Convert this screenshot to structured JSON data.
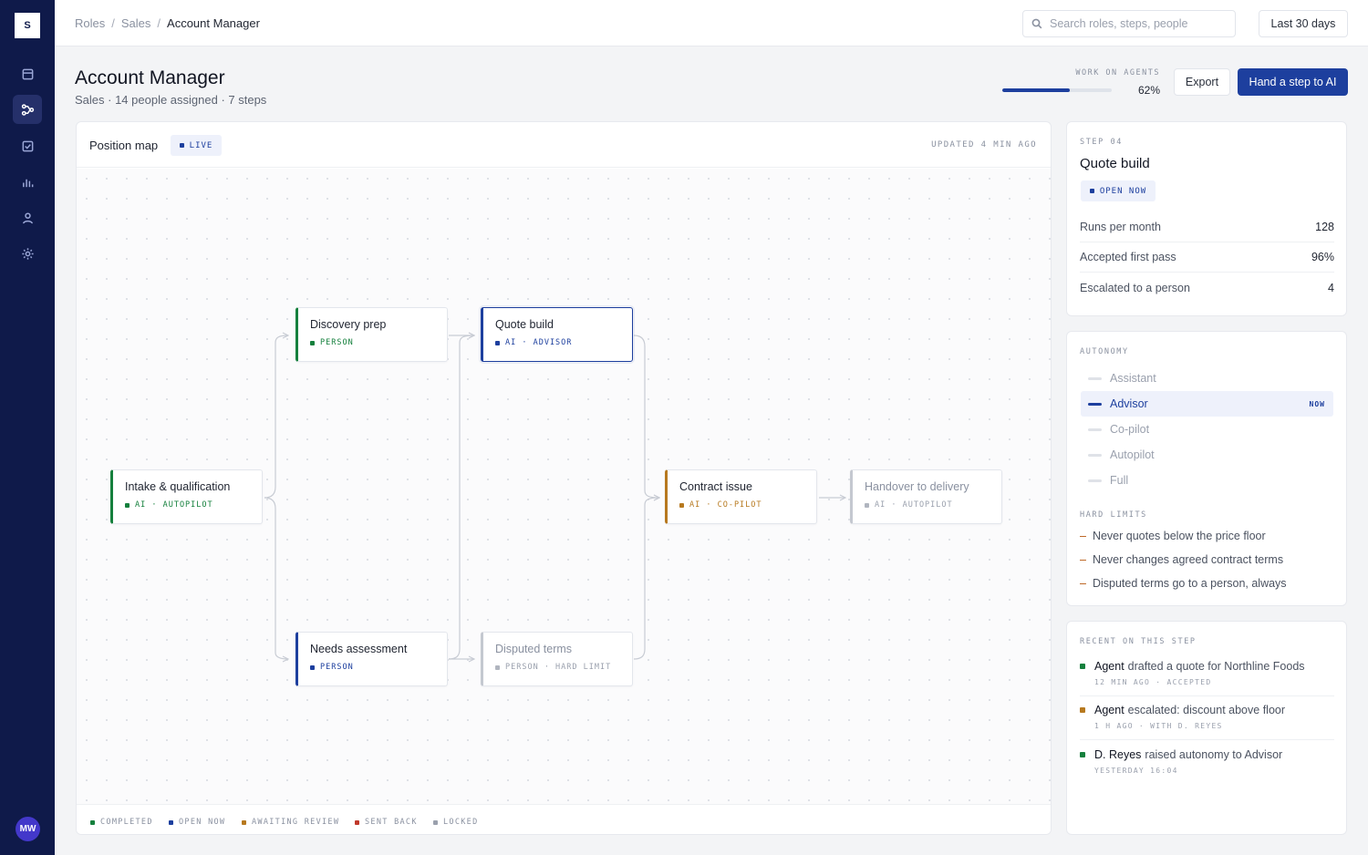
{
  "app": {
    "logo": "S",
    "user_initials": "MW"
  },
  "colors": {
    "sidebar": "#0f1a4a",
    "primary": "#1d3f9e",
    "completed": "#15803d",
    "open_now": "#1d3f9e",
    "awaiting_review": "#b7791f",
    "sent_back": "#c0392b",
    "locked": "#9aa0ad"
  },
  "sidebar": {
    "items": [
      {
        "icon": "inbox-icon",
        "active": false
      },
      {
        "icon": "workflow-icon",
        "active": true
      },
      {
        "icon": "checkbox-icon",
        "active": false
      },
      {
        "icon": "bar-chart-icon",
        "active": false
      },
      {
        "icon": "person-icon",
        "active": false
      },
      {
        "icon": "gear-icon",
        "active": false
      }
    ]
  },
  "breadcrumb": [
    "Roles",
    "Sales",
    "Account Manager"
  ],
  "search": {
    "placeholder": "Search roles, steps, people",
    "value": ""
  },
  "date_range": "Last 30 days",
  "header": {
    "title": "Account Manager",
    "subtitle": "Sales · 14 people assigned · 7 steps",
    "work_on_agents_label": "WORK ON AGENTS",
    "work_on_agents_value": "62%",
    "work_on_agents_fraction": 0.62,
    "export_label": "Export",
    "hand_label": "Hand a step to AI"
  },
  "map": {
    "title": "Position map",
    "live": "LIVE",
    "updated": "UPDATED 4 MIN AGO",
    "nodes": [
      {
        "id": "intake",
        "title": "Intake & qualification",
        "meta": "AI · AUTOPILOT",
        "status": "completed"
      },
      {
        "id": "discovery",
        "title": "Discovery prep",
        "meta": "PERSON",
        "status": "completed"
      },
      {
        "id": "needs",
        "title": "Needs assessment",
        "meta": "PERSON",
        "status": "open"
      },
      {
        "id": "quote",
        "title": "Quote build",
        "meta": "AI · ADVISOR",
        "status": "open",
        "selected": true
      },
      {
        "id": "disputed",
        "title": "Disputed terms",
        "meta": "PERSON · HARD LIMIT",
        "status": "locked"
      },
      {
        "id": "contract",
        "title": "Contract issue",
        "meta": "AI · CO-PILOT",
        "status": "awaiting"
      },
      {
        "id": "handover",
        "title": "Handover to delivery",
        "meta": "AI · AUTOPILOT",
        "status": "locked"
      }
    ],
    "legend": [
      "COMPLETED",
      "OPEN NOW",
      "AWAITING REVIEW",
      "SENT BACK",
      "LOCKED"
    ]
  },
  "step": {
    "label": "STEP 04",
    "title": "Quote build",
    "badge": "OPEN NOW",
    "stats": [
      {
        "label": "Runs per month",
        "value": "128"
      },
      {
        "label": "Accepted first pass",
        "value": "96%"
      },
      {
        "label": "Escalated to a person",
        "value": "4"
      }
    ]
  },
  "autonomy": {
    "label": "AUTONOMY",
    "levels": [
      "Assistant",
      "Advisor",
      "Co-pilot",
      "Autopilot",
      "Full"
    ],
    "current": "Advisor",
    "now_label": "NOW",
    "limits_label": "HARD LIMITS",
    "limits": [
      "Never quotes below the price floor",
      "Never changes agreed contract terms",
      "Disputed terms go to a person, always"
    ]
  },
  "recent": {
    "label": "RECENT ON THIS STEP",
    "items": [
      {
        "actor": "Agent",
        "text": "drafted a quote for Northline Foods",
        "meta": "12 MIN AGO · ACCEPTED",
        "status": "completed"
      },
      {
        "actor": "Agent",
        "text": "escalated: discount above floor",
        "meta": "1 H AGO · WITH D. REYES",
        "status": "awaiting"
      },
      {
        "actor": "D. Reyes",
        "text": "raised autonomy to Advisor",
        "meta": "YESTERDAY 16:04",
        "status": "completed"
      }
    ]
  }
}
